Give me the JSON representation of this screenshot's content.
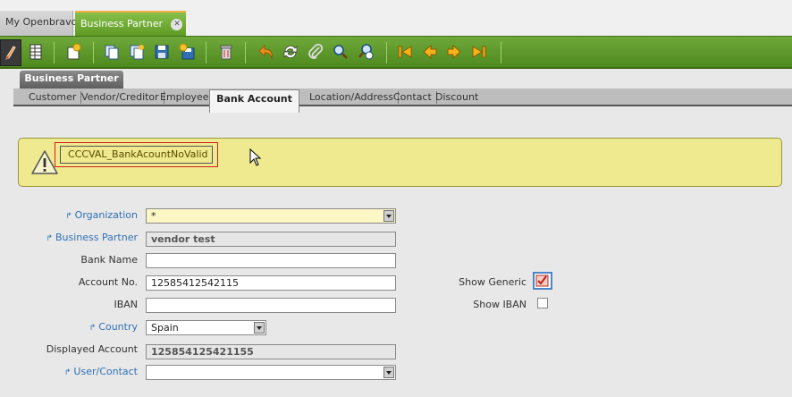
{
  "tabs": [
    {
      "label": "My Openbravo"
    },
    {
      "label": "Business Partner",
      "close": "✕"
    }
  ],
  "toolbar": {
    "icons": [
      "edit-icon",
      "grid-view-icon",
      "new-record-icon",
      "copy-icon",
      "copy-record-icon",
      "save-icon",
      "save-new-icon",
      "delete-icon",
      "undo-icon",
      "refresh-icon",
      "attachment-icon",
      "search-icon",
      "advanced-search-icon",
      "first-record-icon",
      "previous-record-icon",
      "next-record-icon",
      "last-record-icon"
    ]
  },
  "window": {
    "title": "Business Partner",
    "subtabs": [
      "Customer",
      "Vendor/Creditor",
      "Employee",
      "Bank Account",
      "Location/Address",
      "Contact",
      "Discount"
    ],
    "active_subtab": "Bank Account"
  },
  "message": {
    "type": "warning",
    "text": "CCCVAL_BankAcountNoValid"
  },
  "form": {
    "organization": {
      "label": "Organization",
      "value": "*"
    },
    "business_partner": {
      "label": "Business Partner",
      "value": "vendor test"
    },
    "bank_name": {
      "label": "Bank Name",
      "value": ""
    },
    "account_no": {
      "label": "Account No.",
      "value": "12585412542115"
    },
    "iban": {
      "label": "IBAN",
      "value": ""
    },
    "country": {
      "label": "Country",
      "value": "Spain"
    },
    "displayed_account": {
      "label": "Displayed Account",
      "value": "125854125421155"
    },
    "user_contact": {
      "label": "User/Contact",
      "value": ""
    },
    "show_generic": {
      "label": "Show Generic",
      "checked": true
    },
    "show_iban": {
      "label": "Show IBAN",
      "checked": false
    }
  },
  "colors": {
    "toolbar_green": "#5f9a25",
    "warning_bg": "#efe98f",
    "error_border": "#d21f1f",
    "link_blue": "#2f71b5"
  }
}
